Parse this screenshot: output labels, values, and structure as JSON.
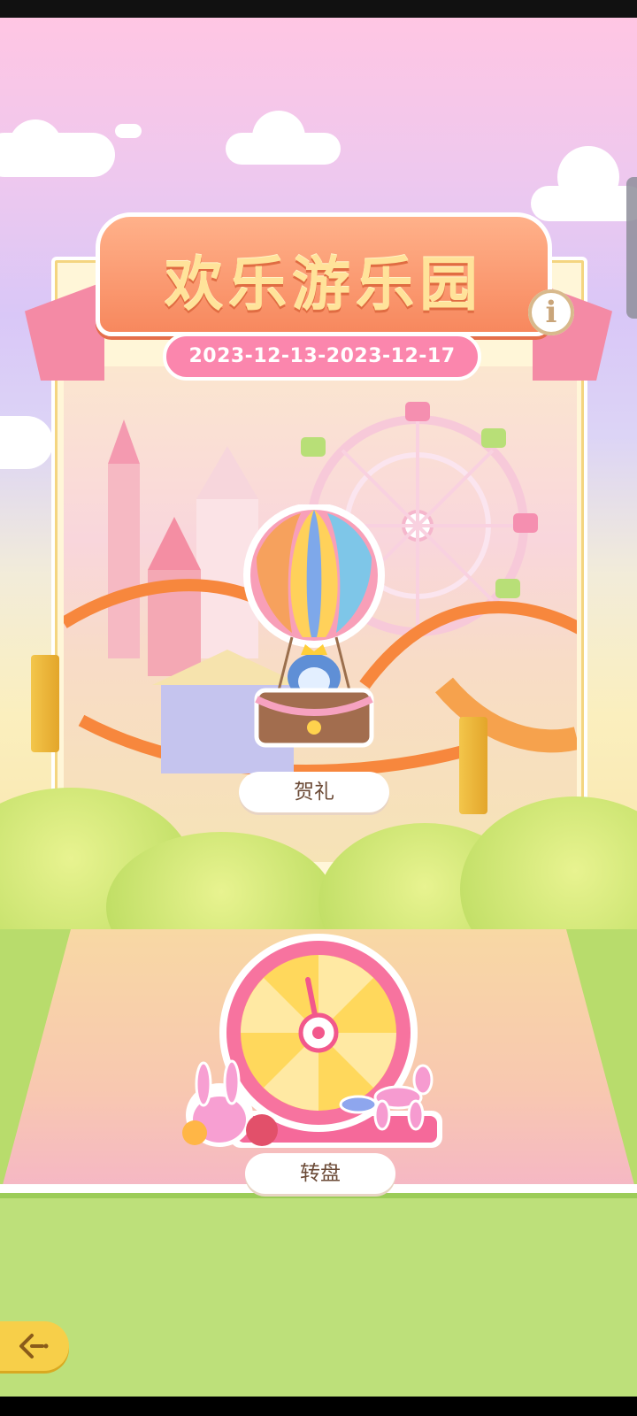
{
  "park": {
    "title": "欢乐游乐园",
    "date_range": "2023-12-13-2023-12-17",
    "info_label": "i"
  },
  "attractions": {
    "gift": {
      "label": "贺礼",
      "icon": "hot-air-balloon-penguin-icon"
    },
    "wheel": {
      "label": "转盘",
      "icon": "prize-wheel-icon"
    }
  },
  "nav": {
    "back_icon": "back-arrow-icon"
  },
  "colors": {
    "banner": "#f7885e",
    "banner_text": "#ffe39a",
    "date_pill": "#fb86ad",
    "track": "#f7873d",
    "lawn": "#bde07a",
    "back_button": "#f7cf49"
  }
}
